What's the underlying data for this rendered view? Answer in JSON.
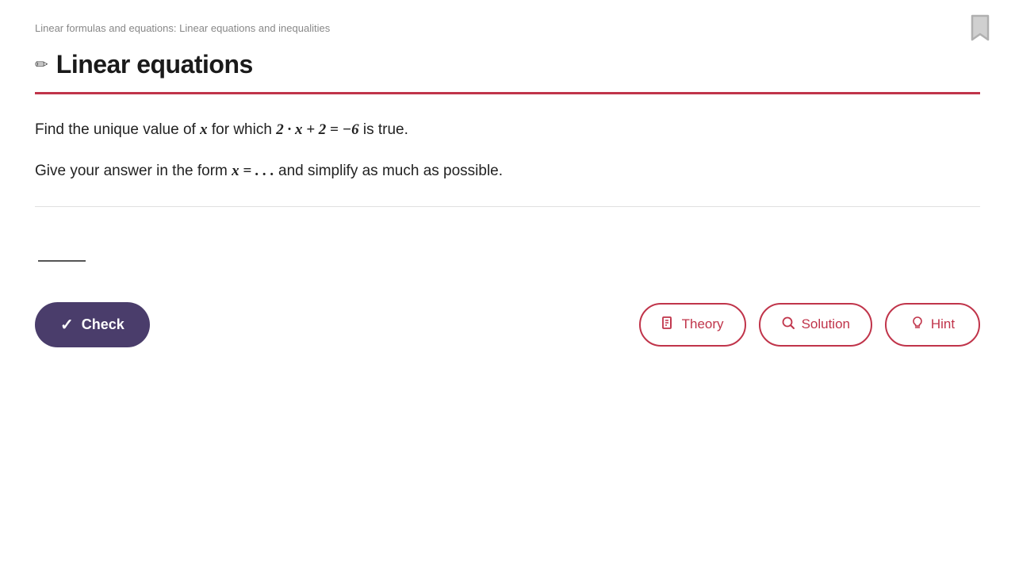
{
  "breadcrumb": {
    "text": "Linear formulas and equations: Linear equations and inequalities"
  },
  "title": {
    "icon": "✏",
    "text": "Linear equations"
  },
  "problem": {
    "line1_before": "Find the unique value of ",
    "line1_var": "x",
    "line1_after": " for which ",
    "equation": "2 · x + 2 = −6",
    "line1_end": " is true.",
    "line2_before": "Give your answer in the form ",
    "line2_form": "x = . . .",
    "line2_after": " and simplify as much as possible."
  },
  "buttons": {
    "check": "Check",
    "theory": "Theory",
    "solution": "Solution",
    "hint": "Hint"
  },
  "icons": {
    "check": "✓",
    "theory": "📖",
    "solution": "🔍",
    "hint": "💡",
    "bookmark": "🔖"
  }
}
